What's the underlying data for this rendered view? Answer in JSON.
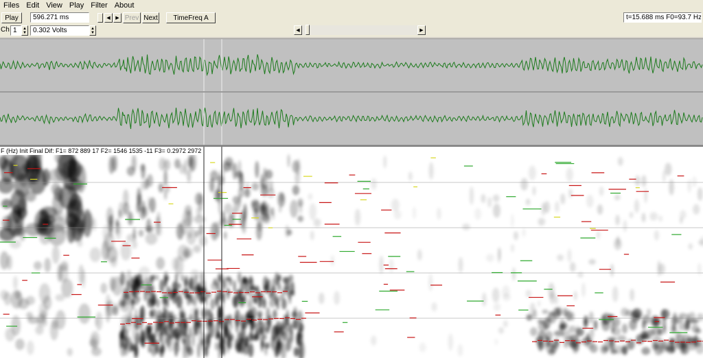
{
  "menu": [
    "Files",
    "Edit",
    "View",
    "Play",
    "Filter",
    "About"
  ],
  "toolbar": {
    "play_label": "Play",
    "duration_value": "596.271 ms",
    "prev_label": "Prev",
    "next_label": "Next",
    "timefreq_label": "TimeFreq A",
    "channel_label": "Ch",
    "channel_value": "1",
    "voltage_value": "0.302 Volts",
    "status_value": "t=15.688 ms  F0=93.7 Hz"
  },
  "spectrogram": {
    "header": "F (Hz) Init Final Dif:  F1=  872  889   17  F2= 1546 1535   -11  F3=   0.2972  2972"
  },
  "colors": {
    "waveform": "#1c7a1c",
    "waveform_bg": "#c0c0c0",
    "formant_red": "#c81414",
    "formant_green": "#2ca82c",
    "formant_yellow": "#d8d820"
  }
}
